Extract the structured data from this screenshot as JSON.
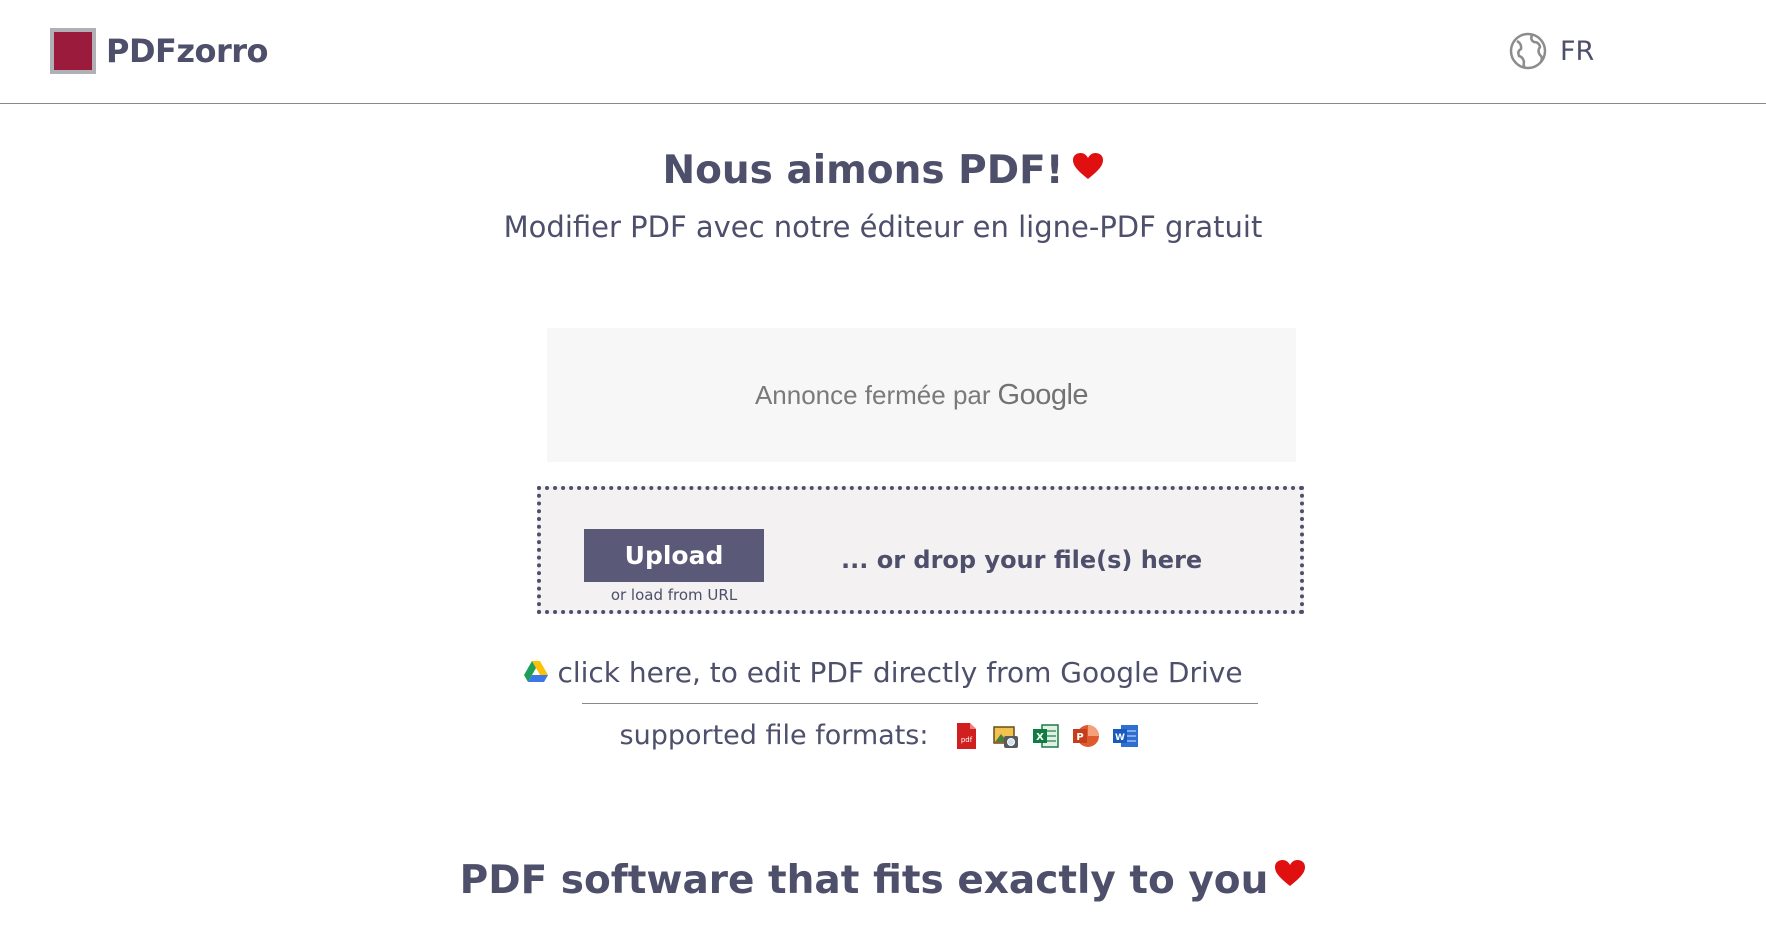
{
  "header": {
    "logo_text": "PDFzorro",
    "language_code": "FR",
    "brand_color": "#9b1b3c"
  },
  "hero": {
    "title": "Nous aimons PDF!",
    "subtitle": "Modifier PDF avec notre éditeur en ligne-PDF gratuit",
    "heart_icon": "heart-icon"
  },
  "ad": {
    "text": "Annonce fermée par",
    "brand": "Google"
  },
  "upload": {
    "button_label": "Upload",
    "url_link": "or load from URL",
    "drop_text": "... or drop your file(s) here"
  },
  "gdrive": {
    "text": "click here, to edit PDF directly from Google Drive",
    "icon": "google-drive-icon"
  },
  "formats": {
    "label": "supported file formats:",
    "items": [
      "pdf",
      "image",
      "excel",
      "powerpoint",
      "word"
    ]
  },
  "bottom": {
    "title": "PDF software that fits exactly to you"
  },
  "colors": {
    "text": "#4d4f6b",
    "button": "#5a5a78",
    "heart": "#e01010",
    "dropzone_bg": "#f3f1f2"
  }
}
